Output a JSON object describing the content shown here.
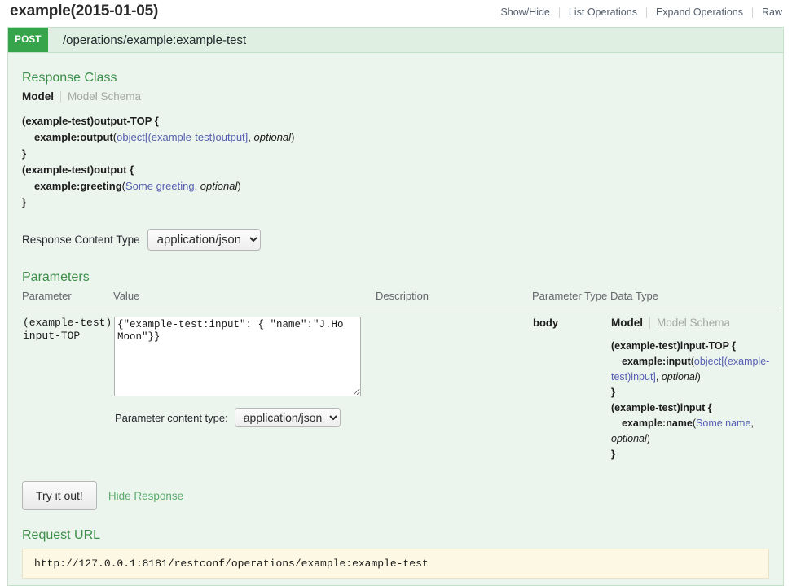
{
  "header": {
    "title": "example(2015-01-05)",
    "nav": [
      {
        "label": "Show/Hide"
      },
      {
        "label": "List Operations"
      },
      {
        "label": "Expand Operations"
      },
      {
        "label": "Raw"
      }
    ]
  },
  "operation": {
    "method": "POST",
    "path": "/operations/example:example-test"
  },
  "response_class": {
    "heading": "Response Class",
    "tab_model": "Model",
    "tab_model_schema": "Model Schema",
    "signature": {
      "block1_open": "(example-test)output-TOP {",
      "prop1_name": "example:output",
      "prop1_open": "(",
      "prop1_type": "object[(example-test)output]",
      "prop1_comma": ", ",
      "prop1_optional": "optional",
      "prop1_close": ")",
      "block1_close": "}",
      "block2_open": "(example-test)output {",
      "prop2_name": "example:greeting",
      "prop2_open": "(",
      "prop2_type": "Some greeting",
      "prop2_comma": ", ",
      "prop2_optional": "optional",
      "prop2_close": ")",
      "block2_close": "}"
    },
    "content_type_label": "Response Content Type",
    "content_type_value": "application/json",
    "content_type_options": [
      "application/json"
    ]
  },
  "parameters": {
    "heading": "Parameters",
    "columns": {
      "parameter": "Parameter",
      "value": "Value",
      "description": "Description",
      "parameter_type": "Parameter Type",
      "data_type": "Data Type"
    },
    "rows": [
      {
        "name": "(example-test)input-TOP",
        "value": "{\"example-test:input\": { \"name\":\"J.Ho Moon\"}}",
        "value_placeholder": "",
        "description": "",
        "parameter_type": "body",
        "content_type_label": "Parameter content type:",
        "content_type_value": "application/json",
        "content_type_options": [
          "application/json"
        ],
        "data_type": {
          "tab_model": "Model",
          "tab_model_schema": "Model Schema",
          "block1_open": "(example-test)input-TOP {",
          "prop1_name": "example:input",
          "prop1_open": "(",
          "prop1_type": "object[(example-test)input]",
          "prop1_comma": ", ",
          "prop1_optional": "optional",
          "prop1_close": ")",
          "block1_close": "}",
          "block2_open": "(example-test)input {",
          "prop2_name": "example:name",
          "prop2_open": "(",
          "prop2_type": "Some name",
          "prop2_comma": ", ",
          "prop2_optional": "optional",
          "prop2_close": ")",
          "block2_close": "}"
        }
      }
    ]
  },
  "actions": {
    "try_it_out": "Try it out!",
    "hide_response": "Hide Response"
  },
  "request_url": {
    "heading": "Request URL",
    "url": "http://127.0.0.1:8181/restconf/operations/example:example-test"
  },
  "colors": {
    "method_post": "#36a44b",
    "section_heading": "#3b8f48",
    "panel_bg": "#ecf4ee",
    "op_bar_bg": "#dff0e2",
    "link_type": "#5560b0",
    "request_url_bg": "#fcf8e3"
  }
}
